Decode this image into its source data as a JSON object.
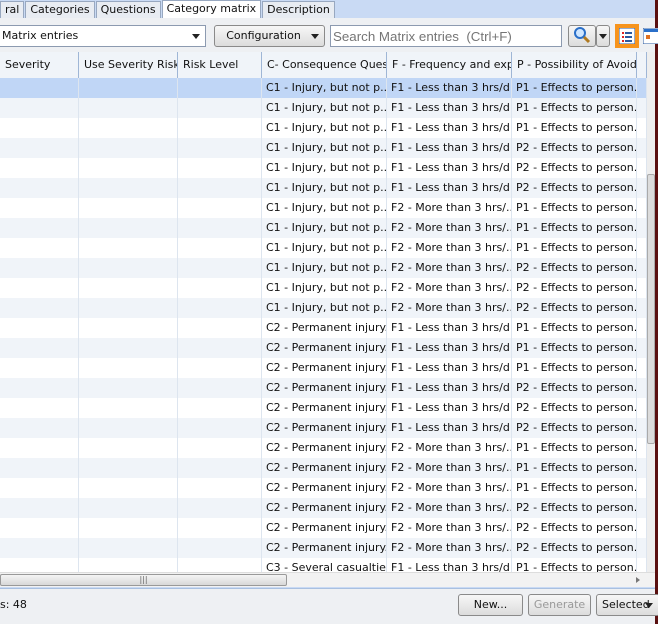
{
  "tabs": [
    "ral",
    "Categories",
    "Questions",
    "Category matrix",
    "Description"
  ],
  "toolbar": {
    "view_select": "Matrix entries",
    "configuration": "Configuration",
    "search_placeholder": "Search Matrix entries  (Ctrl+F)"
  },
  "columns": [
    "Severity",
    "Use Severity Risk...",
    "Risk Level",
    "C- Consequence Ques...",
    "F - Frequency and exp...",
    "P - Possibility of Avoida..."
  ],
  "rows": [
    [
      "C1 - Injury, but not p...",
      "F1 - Less than 3 hrs/d...",
      "P1 - Effects to person..."
    ],
    [
      "C1 - Injury, but not p...",
      "F1 - Less than 3 hrs/d...",
      "P1 - Effects to person..."
    ],
    [
      "C1 - Injury, but not p...",
      "F1 - Less than 3 hrs/d...",
      "P1 - Effects to person..."
    ],
    [
      "C1 - Injury, but not p...",
      "F1 - Less than 3 hrs/d...",
      "P2 - Effects to person..."
    ],
    [
      "C1 - Injury, but not p...",
      "F1 - Less than 3 hrs/d...",
      "P2 - Effects to person..."
    ],
    [
      "C1 - Injury, but not p...",
      "F1 - Less than 3 hrs/d...",
      "P2 - Effects to person..."
    ],
    [
      "C1 - Injury, but not p...",
      "F2 - More than 3 hrs/...",
      "P1 - Effects to person..."
    ],
    [
      "C1 - Injury, but not p...",
      "F2 - More than 3 hrs/...",
      "P1 - Effects to person..."
    ],
    [
      "C1 - Injury, but not p...",
      "F2 - More than 3 hrs/...",
      "P1 - Effects to person..."
    ],
    [
      "C1 - Injury, but not p...",
      "F2 - More than 3 hrs/...",
      "P2 - Effects to person..."
    ],
    [
      "C1 - Injury, but not p...",
      "F2 - More than 3 hrs/...",
      "P2 - Effects to person..."
    ],
    [
      "C1 - Injury, but not p...",
      "F2 - More than 3 hrs/...",
      "P2 - Effects to person..."
    ],
    [
      "C2 - Permanent injury...",
      "F1 - Less than 3 hrs/d...",
      "P1 - Effects to person..."
    ],
    [
      "C2 - Permanent injury...",
      "F1 - Less than 3 hrs/d...",
      "P1 - Effects to person..."
    ],
    [
      "C2 - Permanent injury...",
      "F1 - Less than 3 hrs/d...",
      "P1 - Effects to person..."
    ],
    [
      "C2 - Permanent injury...",
      "F1 - Less than 3 hrs/d...",
      "P2 - Effects to person..."
    ],
    [
      "C2 - Permanent injury...",
      "F1 - Less than 3 hrs/d...",
      "P2 - Effects to person..."
    ],
    [
      "C2 - Permanent injury...",
      "F1 - Less than 3 hrs/d...",
      "P2 - Effects to person..."
    ],
    [
      "C2 - Permanent injury...",
      "F2 - More than 3 hrs/...",
      "P1 - Effects to person..."
    ],
    [
      "C2 - Permanent injury...",
      "F2 - More than 3 hrs/...",
      "P1 - Effects to person..."
    ],
    [
      "C2 - Permanent injury...",
      "F2 - More than 3 hrs/...",
      "P1 - Effects to person..."
    ],
    [
      "C2 - Permanent injury...",
      "F2 - More than 3 hrs/...",
      "P2 - Effects to person..."
    ],
    [
      "C2 - Permanent injury...",
      "F2 - More than 3 hrs/...",
      "P2 - Effects to person..."
    ],
    [
      "C2 - Permanent injury...",
      "F2 - More than 3 hrs/...",
      "P2 - Effects to person..."
    ],
    [
      "C3 - Several casualties",
      "F1 - Less than 3 hrs/d...",
      "P1 - Effects to person..."
    ]
  ],
  "footer": {
    "count": "s: 48",
    "new": "New...",
    "generate": "Generate",
    "selected": "Selected"
  }
}
